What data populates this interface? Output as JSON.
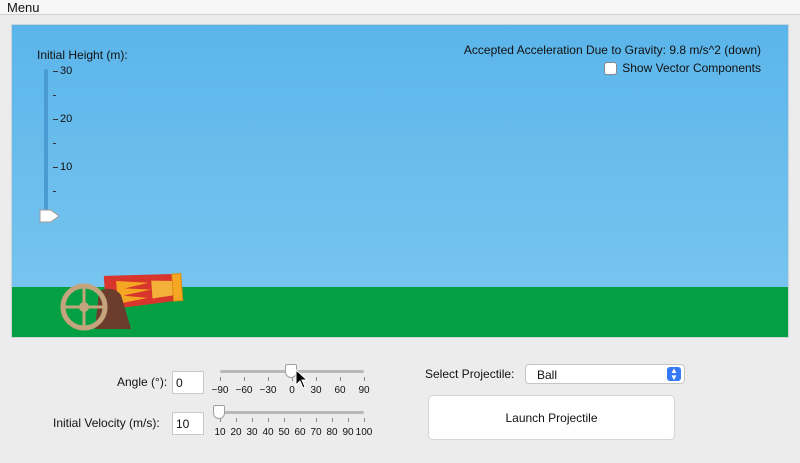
{
  "menubar": {
    "label": "Menu"
  },
  "scene": {
    "height_slider": {
      "title": "Initial Height (m):",
      "tick_labels": [
        "30",
        "20",
        "10"
      ],
      "value_m": 0,
      "max_m": 30
    },
    "gravity_text": "Accepted Acceleration Due to Gravity: 9.8 m/s^2 (down)",
    "vector_components": {
      "label": "Show Vector Components",
      "checked": false
    },
    "colors": {
      "sky": "#5bb5ea",
      "ground": "#04a043"
    }
  },
  "controls": {
    "angle": {
      "label": "Angle (°):",
      "value": "0",
      "min": -90,
      "max": 90,
      "tick_labels": [
        "−90",
        "−60",
        "−30",
        "0",
        "30",
        "60",
        "90"
      ]
    },
    "velocity": {
      "label": "Initial Velocity (m/s):",
      "value": "10",
      "min": 10,
      "max": 100,
      "tick_labels": [
        "10",
        "20",
        "30",
        "40",
        "50",
        "60",
        "70",
        "80",
        "90",
        "100"
      ]
    },
    "projectile": {
      "label": "Select Projectile:",
      "selected": "Ball"
    },
    "launch_label": "Launch Projectile"
  }
}
